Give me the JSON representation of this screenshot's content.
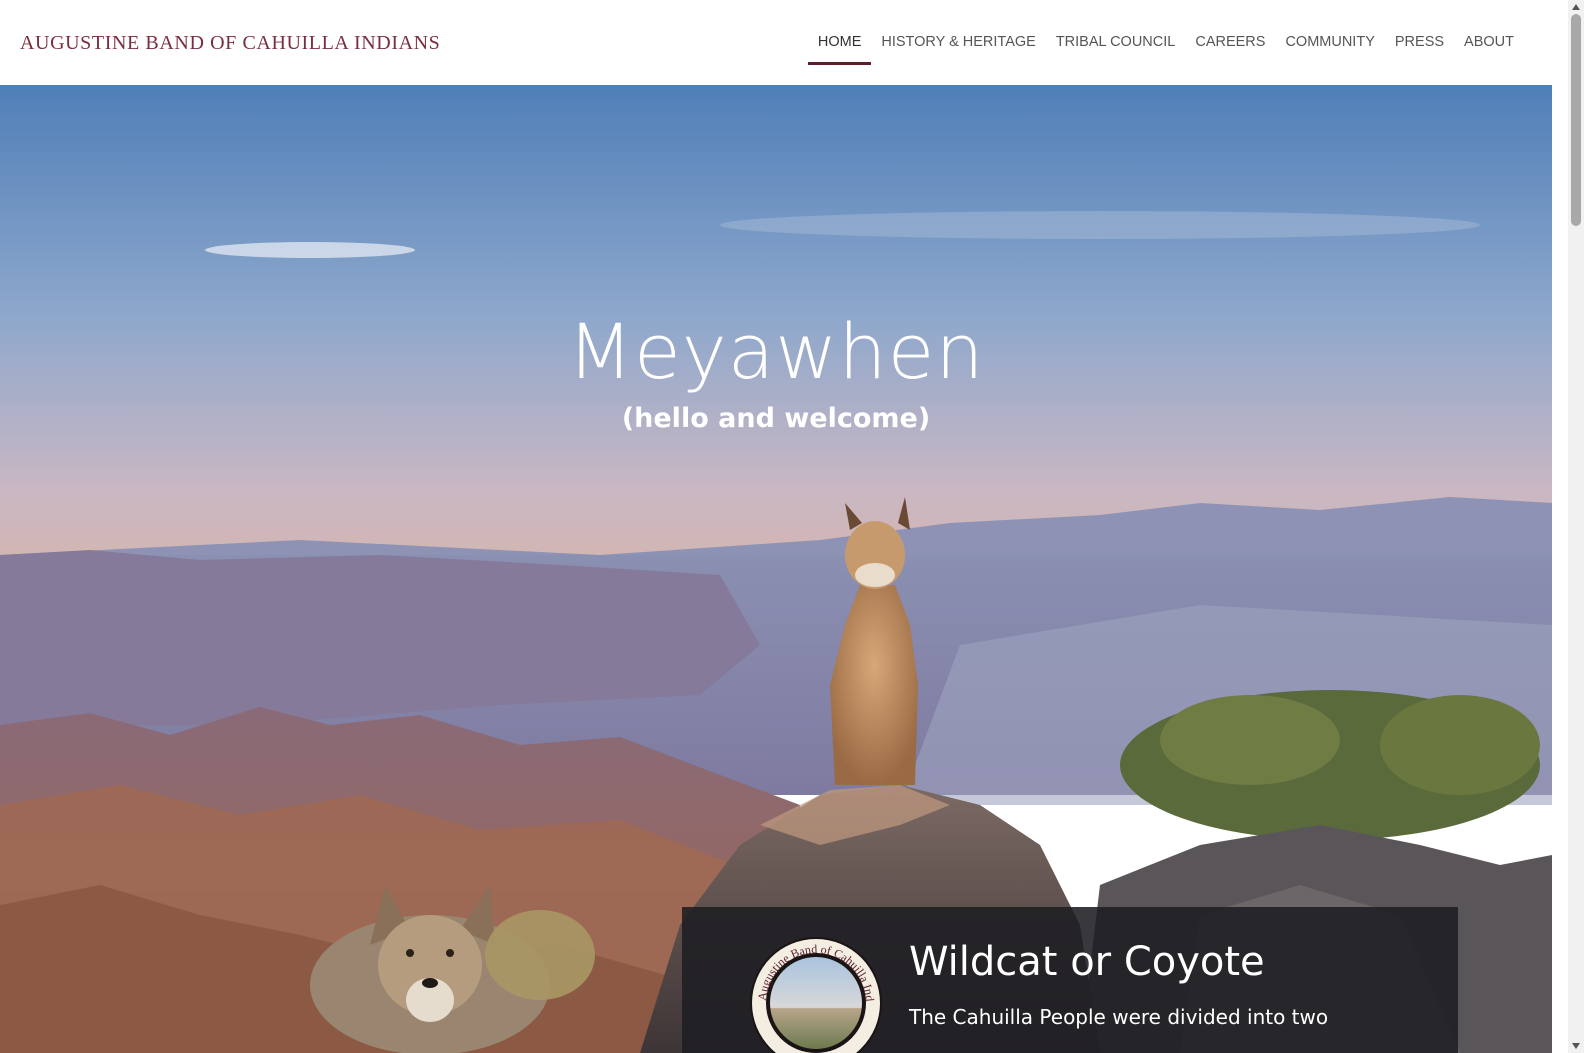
{
  "header": {
    "logo_text": "AUGUSTINE BAND OF CAHUILLA INDIANS",
    "nav": [
      {
        "label": "HOME",
        "active": true
      },
      {
        "label": "HISTORY & HERITAGE"
      },
      {
        "label": "TRIBAL COUNCIL"
      },
      {
        "label": "CAREERS"
      },
      {
        "label": "COMMUNITY"
      },
      {
        "label": "PRESS"
      },
      {
        "label": "ABOUT"
      }
    ]
  },
  "hero": {
    "title": "Meyawhen",
    "subtitle": "(hello and welcome)",
    "image_subjects": [
      "mountain-landscape",
      "bobcat",
      "coyote"
    ]
  },
  "card": {
    "seal_text": "Augustine Band of Cahuilla Indians",
    "title": "Wildcat or Coyote",
    "text": "The Cahuilla People were divided into two"
  },
  "colors": {
    "brand": "#7a2d3e",
    "active_underline": "#5a1f2b",
    "nav_text": "#555555"
  }
}
